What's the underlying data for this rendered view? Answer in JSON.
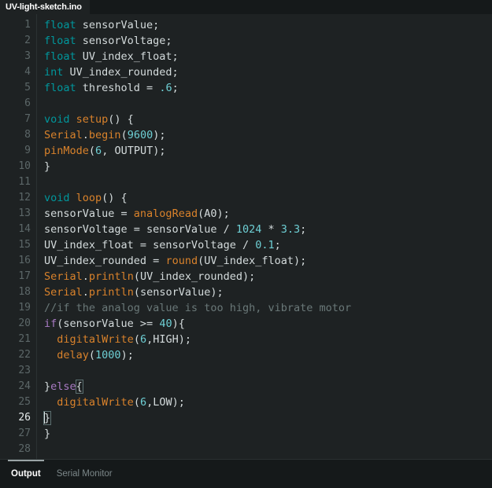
{
  "window": {
    "background_color": "#1e2223",
    "panel_color": "#15191a"
  },
  "tabbar": {
    "tabs": [
      {
        "label": "UV-light-sketch.ino",
        "active": true
      }
    ]
  },
  "editor": {
    "active_line": 26,
    "cursor_line": 26,
    "cursor_column": 1,
    "total_lines": 28,
    "line_numbers": [
      1,
      2,
      3,
      4,
      5,
      6,
      7,
      8,
      9,
      10,
      11,
      12,
      13,
      14,
      15,
      16,
      17,
      18,
      19,
      20,
      21,
      22,
      23,
      24,
      25,
      26,
      27,
      28
    ],
    "colors": {
      "type_keyword": "#00979c",
      "function": "#d9822b",
      "number": "#6ecfd4",
      "control_keyword": "#a97bc4",
      "comment": "#6a7878",
      "identifier": "#d4dbdc"
    },
    "lines": [
      {
        "n": 1,
        "text": "float sensorValue;",
        "tokens": [
          {
            "t": "float",
            "c": "t-type"
          },
          {
            "t": " sensorValue;",
            "c": "t-plain"
          }
        ]
      },
      {
        "n": 2,
        "text": "float sensorVoltage;",
        "tokens": [
          {
            "t": "float",
            "c": "t-type"
          },
          {
            "t": " sensorVoltage;",
            "c": "t-plain"
          }
        ]
      },
      {
        "n": 3,
        "text": "float UV_index_float;",
        "tokens": [
          {
            "t": "float",
            "c": "t-type"
          },
          {
            "t": " UV_index_float;",
            "c": "t-plain"
          }
        ]
      },
      {
        "n": 4,
        "text": "int UV_index_rounded;",
        "tokens": [
          {
            "t": "int",
            "c": "t-type"
          },
          {
            "t": " UV_index_rounded;",
            "c": "t-plain"
          }
        ]
      },
      {
        "n": 5,
        "text": "float threshold = .6;",
        "tokens": [
          {
            "t": "float",
            "c": "t-type"
          },
          {
            "t": " threshold = ",
            "c": "t-plain"
          },
          {
            "t": ".6",
            "c": "t-num"
          },
          {
            "t": ";",
            "c": "t-plain"
          }
        ]
      },
      {
        "n": 6,
        "text": "",
        "tokens": []
      },
      {
        "n": 7,
        "text": "void setup() {",
        "tokens": [
          {
            "t": "void",
            "c": "t-type"
          },
          {
            "t": " ",
            "c": "t-plain"
          },
          {
            "t": "setup",
            "c": "t-fn"
          },
          {
            "t": "() {",
            "c": "t-plain"
          }
        ]
      },
      {
        "n": 8,
        "text": "Serial.begin(9600);",
        "tokens": [
          {
            "t": "Serial",
            "c": "t-fn"
          },
          {
            "t": ".",
            "c": "t-plain"
          },
          {
            "t": "begin",
            "c": "t-fn"
          },
          {
            "t": "(",
            "c": "t-plain"
          },
          {
            "t": "9600",
            "c": "t-num"
          },
          {
            "t": ");",
            "c": "t-plain"
          }
        ]
      },
      {
        "n": 9,
        "text": "pinMode(6, OUTPUT);",
        "tokens": [
          {
            "t": "pinMode",
            "c": "t-fn"
          },
          {
            "t": "(",
            "c": "t-plain"
          },
          {
            "t": "6",
            "c": "t-num"
          },
          {
            "t": ", OUTPUT);",
            "c": "t-plain"
          }
        ]
      },
      {
        "n": 10,
        "text": "}",
        "tokens": [
          {
            "t": "}",
            "c": "t-plain"
          }
        ]
      },
      {
        "n": 11,
        "text": "",
        "tokens": []
      },
      {
        "n": 12,
        "text": "void loop() {",
        "tokens": [
          {
            "t": "void",
            "c": "t-type"
          },
          {
            "t": " ",
            "c": "t-plain"
          },
          {
            "t": "loop",
            "c": "t-fn"
          },
          {
            "t": "() {",
            "c": "t-plain"
          }
        ]
      },
      {
        "n": 13,
        "text": "sensorValue = analogRead(A0);",
        "tokens": [
          {
            "t": "sensorValue = ",
            "c": "t-plain"
          },
          {
            "t": "analogRead",
            "c": "t-fn"
          },
          {
            "t": "(A0);",
            "c": "t-plain"
          }
        ]
      },
      {
        "n": 14,
        "text": "sensorVoltage = sensorValue / 1024 * 3.3;",
        "tokens": [
          {
            "t": "sensorVoltage = sensorValue / ",
            "c": "t-plain"
          },
          {
            "t": "1024",
            "c": "t-num"
          },
          {
            "t": " * ",
            "c": "t-plain"
          },
          {
            "t": "3.3",
            "c": "t-num"
          },
          {
            "t": ";",
            "c": "t-plain"
          }
        ]
      },
      {
        "n": 15,
        "text": "UV_index_float = sensorVoltage / 0.1;",
        "tokens": [
          {
            "t": "UV_index_float = sensorVoltage / ",
            "c": "t-plain"
          },
          {
            "t": "0.1",
            "c": "t-num"
          },
          {
            "t": ";",
            "c": "t-plain"
          }
        ]
      },
      {
        "n": 16,
        "text": "UV_index_rounded = round(UV_index_float);",
        "tokens": [
          {
            "t": "UV_index_rounded = ",
            "c": "t-plain"
          },
          {
            "t": "round",
            "c": "t-fn"
          },
          {
            "t": "(UV_index_float);",
            "c": "t-plain"
          }
        ]
      },
      {
        "n": 17,
        "text": "Serial.println(UV_index_rounded);",
        "tokens": [
          {
            "t": "Serial",
            "c": "t-fn"
          },
          {
            "t": ".",
            "c": "t-plain"
          },
          {
            "t": "println",
            "c": "t-fn"
          },
          {
            "t": "(UV_index_rounded);",
            "c": "t-plain"
          }
        ]
      },
      {
        "n": 18,
        "text": "Serial.println(sensorValue);",
        "tokens": [
          {
            "t": "Serial",
            "c": "t-fn"
          },
          {
            "t": ".",
            "c": "t-plain"
          },
          {
            "t": "println",
            "c": "t-fn"
          },
          {
            "t": "(sensorValue);",
            "c": "t-plain"
          }
        ]
      },
      {
        "n": 19,
        "text": "//if the analog value is too high, vibrate motor",
        "tokens": [
          {
            "t": "//if the analog value is too high, vibrate motor",
            "c": "t-cmt"
          }
        ]
      },
      {
        "n": 20,
        "text": "if(sensorValue >= 40){",
        "tokens": [
          {
            "t": "if",
            "c": "t-ctrl"
          },
          {
            "t": "(sensorValue >= ",
            "c": "t-plain"
          },
          {
            "t": "40",
            "c": "t-num"
          },
          {
            "t": "){",
            "c": "t-plain"
          }
        ]
      },
      {
        "n": 21,
        "text": "  digitalWrite(6,HIGH);",
        "tokens": [
          {
            "t": "  ",
            "c": "t-plain"
          },
          {
            "t": "digitalWrite",
            "c": "t-fn"
          },
          {
            "t": "(",
            "c": "t-plain"
          },
          {
            "t": "6",
            "c": "t-num"
          },
          {
            "t": ",HIGH);",
            "c": "t-plain"
          }
        ]
      },
      {
        "n": 22,
        "text": "  delay(1000);",
        "tokens": [
          {
            "t": "  ",
            "c": "t-plain"
          },
          {
            "t": "delay",
            "c": "t-fn"
          },
          {
            "t": "(",
            "c": "t-plain"
          },
          {
            "t": "1000",
            "c": "t-num"
          },
          {
            "t": ");",
            "c": "t-plain"
          }
        ]
      },
      {
        "n": 23,
        "text": "",
        "tokens": []
      },
      {
        "n": 24,
        "text": "}else{",
        "tokens": [
          {
            "t": "}",
            "c": "t-plain"
          },
          {
            "t": "else",
            "c": "t-ctrl"
          },
          {
            "t": "{",
            "c": "t-brmatch"
          }
        ]
      },
      {
        "n": 25,
        "text": "  digitalWrite(6,LOW);",
        "tokens": [
          {
            "t": "  ",
            "c": "t-plain"
          },
          {
            "t": "digitalWrite",
            "c": "t-fn"
          },
          {
            "t": "(",
            "c": "t-plain"
          },
          {
            "t": "6",
            "c": "t-num"
          },
          {
            "t": ",LOW);",
            "c": "t-plain"
          }
        ]
      },
      {
        "n": 26,
        "text": "}",
        "caret": true,
        "tokens": [
          {
            "t": "}",
            "c": "t-brmatch"
          }
        ]
      },
      {
        "n": 27,
        "text": "}",
        "tokens": [
          {
            "t": "}",
            "c": "t-plain"
          }
        ]
      },
      {
        "n": 28,
        "text": "",
        "tokens": []
      }
    ]
  },
  "bottom_panel": {
    "tabs": [
      {
        "label": "Output",
        "active": true
      },
      {
        "label": "Serial Monitor",
        "active": false
      }
    ]
  }
}
